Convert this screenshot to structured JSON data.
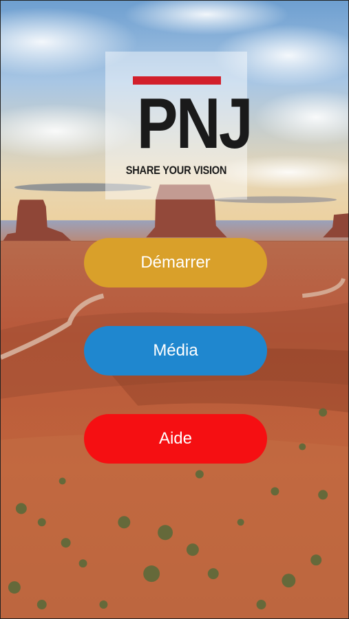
{
  "logo": {
    "mark": "PNJ",
    "tagline": "SHARE YOUR VISION",
    "bar_color": "#d21f2b"
  },
  "menu": {
    "start": {
      "label": "Démarrer",
      "color": "#d9a02a"
    },
    "media": {
      "label": "Média",
      "color": "#1f87cf"
    },
    "help": {
      "label": "Aide",
      "color": "#f50f12"
    }
  },
  "background": {
    "scene": "desert-landscape-with-buttes"
  }
}
